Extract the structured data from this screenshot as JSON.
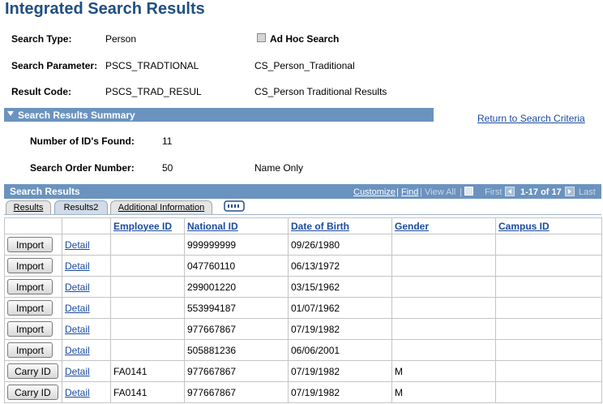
{
  "page": {
    "title": "Integrated Search Results"
  },
  "search_info": {
    "type_label": "Search Type:",
    "type_value": "Person",
    "adhoc_label": "Ad Hoc Search",
    "param_label": "Search Parameter:",
    "param_value": "PSCS_TRADTIONAL",
    "param_desc": "CS_Person_Traditional",
    "result_label": "Result Code:",
    "result_value": "PSCS_TRAD_RESUL",
    "result_desc": "CS_Person Traditional Results"
  },
  "summary": {
    "header": "Search Results Summary",
    "return_link": "Return to Search Criteria",
    "ids_label": "Number of ID's Found:",
    "ids_value": "11",
    "order_label": "Search Order Number:",
    "order_value": "50",
    "order_desc": "Name Only"
  },
  "results": {
    "header": "Search Results",
    "customize": "Customize",
    "separator": "|",
    "find": "Find",
    "view_all": "View All",
    "first": "First",
    "range": "1-17 of 17",
    "last": "Last",
    "tabs": [
      "Results",
      "Results2",
      "Additional Information"
    ],
    "columns": [
      "Employee ID",
      "National ID",
      "Date of Birth",
      "Gender",
      "Campus ID"
    ],
    "rows": [
      {
        "action": "Import",
        "detail": "Detail",
        "emplid": "",
        "national_id": "999999999",
        "dob": "09/26/1980",
        "gender": "",
        "campus_id": ""
      },
      {
        "action": "Import",
        "detail": "Detail",
        "emplid": "",
        "national_id": "047760110",
        "dob": "06/13/1972",
        "gender": "",
        "campus_id": ""
      },
      {
        "action": "Import",
        "detail": "Detail",
        "emplid": "",
        "national_id": "299001220",
        "dob": "03/15/1962",
        "gender": "",
        "campus_id": ""
      },
      {
        "action": "Import",
        "detail": "Detail",
        "emplid": "",
        "national_id": "553994187",
        "dob": "01/07/1962",
        "gender": "",
        "campus_id": ""
      },
      {
        "action": "Import",
        "detail": "Detail",
        "emplid": "",
        "national_id": "977667867",
        "dob": "07/19/1982",
        "gender": "",
        "campus_id": ""
      },
      {
        "action": "Import",
        "detail": "Detail",
        "emplid": "",
        "national_id": "505881236",
        "dob": "06/06/2001",
        "gender": "",
        "campus_id": ""
      },
      {
        "action": "Carry ID",
        "detail": "Detail",
        "emplid": "FA0141",
        "national_id": "977667867",
        "dob": "07/19/1982",
        "gender": "M",
        "campus_id": ""
      },
      {
        "action": "Carry ID",
        "detail": "Detail",
        "emplid": "FA0141",
        "national_id": "977667867",
        "dob": "07/19/1982",
        "gender": "M",
        "campus_id": ""
      }
    ]
  },
  "icons": [
    "checkbox-icon",
    "collapse-triangle-icon",
    "download-icon",
    "prev-arrow-icon",
    "next-arrow-icon",
    "show-all-columns-icon"
  ]
}
